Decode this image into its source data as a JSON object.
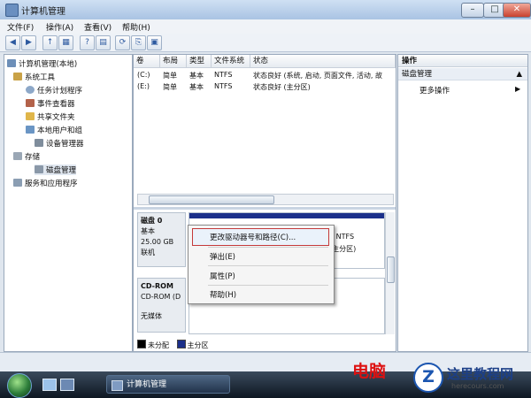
{
  "window": {
    "title": "计算机管理",
    "btn_min": "–",
    "btn_max": "□",
    "btn_close": "✕"
  },
  "menu": [
    "文件(F)",
    "操作(A)",
    "查看(V)",
    "帮助(H)"
  ],
  "toolbar_glyphs": {
    "back": "◀",
    "forward": "▶",
    "up": "↑",
    "view": "▦",
    "help": "?",
    "showhide": "▤",
    "refresh": "⟳",
    "export": "⎘",
    "props": "▣"
  },
  "tree": {
    "root": "计算机管理(本地)",
    "system_tools": "系统工具",
    "task_scheduler": "任务计划程序",
    "event_viewer": "事件查看器",
    "shared_folders": "共享文件夹",
    "local_users": "本地用户和组",
    "device_manager": "设备管理器",
    "storage": "存储",
    "disk_mgmt": "磁盘管理",
    "services": "服务和应用程序"
  },
  "columns": [
    "卷",
    "布局",
    "类型",
    "文件系统",
    "状态"
  ],
  "volumes": [
    {
      "vol": "(C:)",
      "layout": "简单",
      "type": "基本",
      "fs": "NTFS",
      "status": "状态良好 (系统, 启动, 页面文件, 活动, 故"
    },
    {
      "vol": "(E:)",
      "layout": "简单",
      "type": "基本",
      "fs": "NTFS",
      "status": "状态良好 (主分区)"
    }
  ],
  "disk0": {
    "name": "磁盘 0",
    "kind": "基本",
    "size": "25.00 GB",
    "state": "联机",
    "partition_fs": "3 NTFS",
    "partition_status": "(主分区)"
  },
  "cdrom": {
    "name": "CD-ROM",
    "label": "CD-ROM (D",
    "media": "无媒体"
  },
  "legend": {
    "unallocated": "未分配",
    "primary": "主分区"
  },
  "context_menu": [
    "更改驱动器号和路径(C)...",
    "弹出(E)",
    "属性(P)",
    "帮助(H)"
  ],
  "actions": {
    "header": "操作",
    "section": "磁盘管理",
    "more": "更多操作",
    "section_arrow": "▲",
    "more_arrow": "▶"
  },
  "taskbar": {
    "item": "计算机管理"
  },
  "watermark": {
    "left_text": "电脑",
    "logo_letter": "Z",
    "site_name": "这里教程网",
    "site_url": "herecours.com"
  },
  "colors": {
    "unallocated": "#000000",
    "primary": "#1b2f8a",
    "highlight_border": "#c43a3a"
  }
}
